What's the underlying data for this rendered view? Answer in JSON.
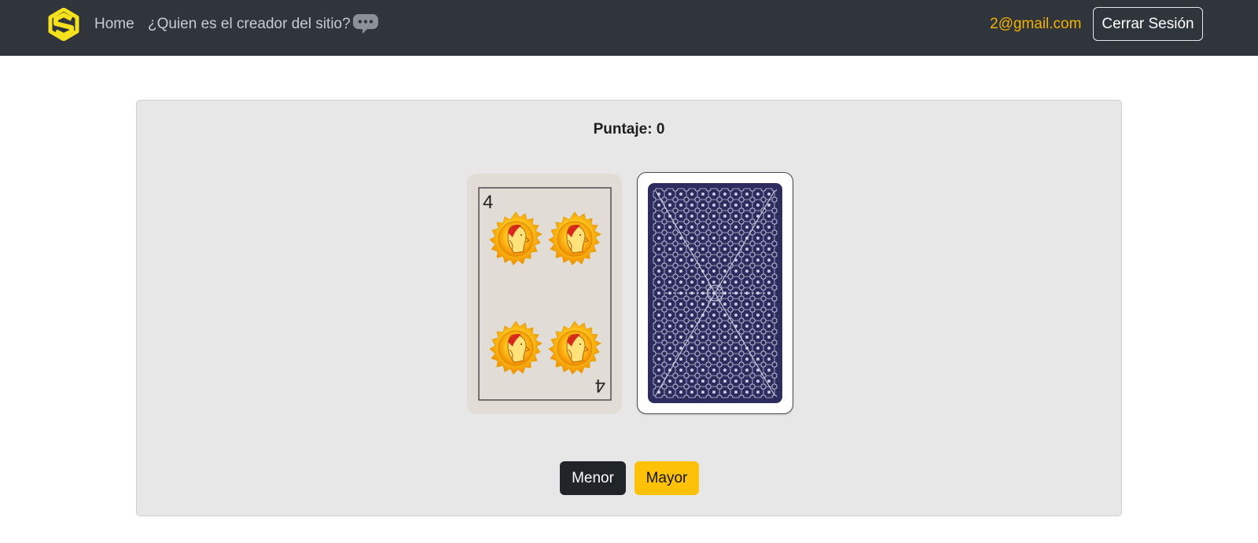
{
  "navbar": {
    "brand_icon": "s-logo-icon",
    "home_label": "Home",
    "creator_label": "¿Quien es el creador del sitio?",
    "chat_icon": "chat-bubbles-icon",
    "user_email": "2@gmail.com",
    "logout_label": "Cerrar Sesión"
  },
  "game": {
    "score_text": "Puntaje: 0",
    "current_card": {
      "rank": "4",
      "suit": "oros"
    },
    "next_card": {
      "face_down": true,
      "back_icon": "card-back-pattern"
    },
    "lower_label": "Menor",
    "higher_label": "Mayor"
  },
  "colors": {
    "navbar_bg": "#30343b",
    "accent": "#fdc107",
    "email": "#f3b300",
    "card_back": "#2c2c5e",
    "dark_button": "#212428"
  }
}
